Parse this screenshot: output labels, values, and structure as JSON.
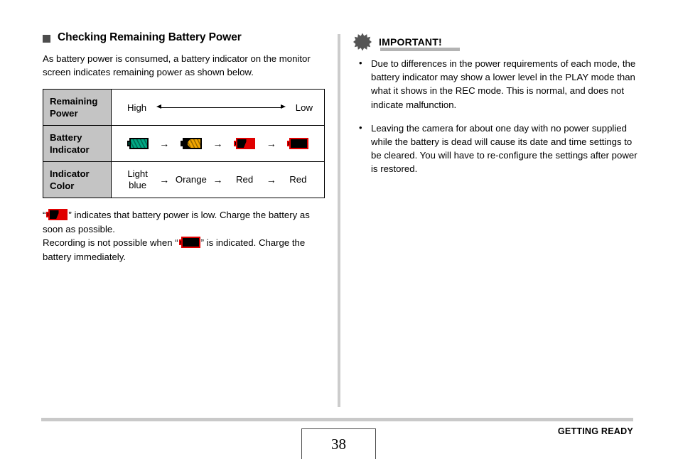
{
  "left": {
    "heading": "Checking Remaining Battery Power",
    "intro": "As battery power is consumed, a battery indicator on the monitor screen indicates remaining power as shown below.",
    "table": {
      "rows": [
        {
          "header": "Remaining Power",
          "type": "range",
          "high_label": "High",
          "low_label": "Low"
        },
        {
          "header": "Battery Indicator",
          "type": "icons",
          "icons": [
            "battery-full-icon",
            "battery-three-quarter-icon",
            "battery-low-icon",
            "battery-empty-icon"
          ],
          "separator": "→"
        },
        {
          "header": "Indicator Color",
          "type": "colors",
          "values": [
            "Light blue",
            "Orange",
            "Red",
            "Red"
          ],
          "separator": "→"
        }
      ]
    },
    "note_1_prefix": "“",
    "note_1_suffix": "” indicates that battery power is low. Charge the battery as soon as possible.",
    "note_2_prefix": "Recording is not possible when “",
    "note_2_suffix": "” is indicated. Charge the battery immediately."
  },
  "right": {
    "important_title": "IMPORTANT!",
    "important_icon": "starburst-icon",
    "bullets": [
      "Due to differences in the power requirements of each mode, the battery indicator may show a lower level in the PLAY mode than what it shows in the REC mode. This is normal, and does not indicate malfunction.",
      "Leaving the camera for about one day with no power supplied while the battery is dead will cause its date and time settings to be cleared. You will have to re-configure the settings after power is restored."
    ]
  },
  "footer": {
    "page_number": "38",
    "section_label": "GETTING READY"
  },
  "colors": {
    "header_cell_bg": "#c4c4c4",
    "divider": "#cccccc",
    "footer_rule": "#c9c9c9",
    "starburst": "#555555",
    "underline": "#b3b3b3",
    "battery_full": "#00a884",
    "battery_orange": "#f0a500",
    "battery_red": "#e00000"
  }
}
